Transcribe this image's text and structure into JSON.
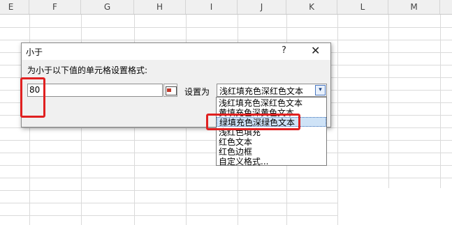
{
  "columns": [
    "E",
    "F",
    "G",
    "H",
    "I",
    "J",
    "K",
    "L",
    "M"
  ],
  "dialog": {
    "title": "小于",
    "help": "?",
    "close": "✕",
    "prompt": "为小于以下值的单元格设置格式:",
    "value": "80",
    "set_label": "设置为",
    "selected_format": "浅红填充色深红色文本",
    "dropdown_arrow": "▾"
  },
  "dropdown": {
    "items": [
      "浅红填充色深红色文本",
      "黄填充色深黄色文本",
      "绿填充色深绿色文本",
      "浅红色填充",
      "红色文本",
      "红色边框",
      "自定义格式..."
    ],
    "highlighted_index": 2
  },
  "colors": {
    "highlight": "#e02020",
    "selected_item_bg": "#cfe3f7"
  },
  "icons": {
    "range_picker": "range-select-icon"
  }
}
